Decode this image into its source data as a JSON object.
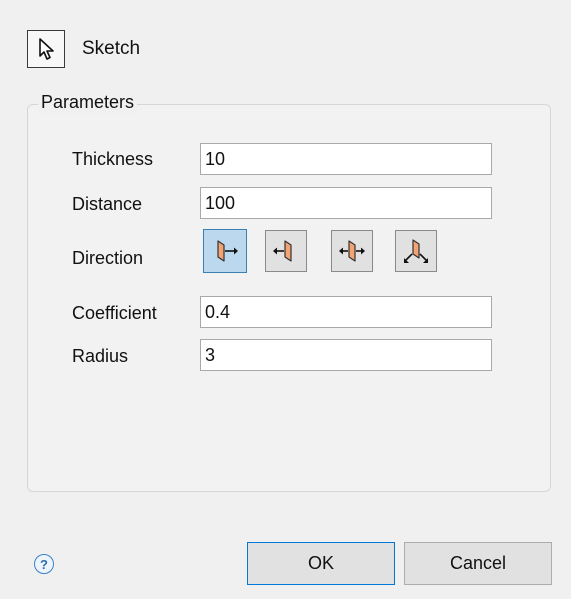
{
  "sketch": {
    "label": "Sketch",
    "icon": "cursor-arrow-icon"
  },
  "parameters": {
    "group_title": "Parameters",
    "fields": {
      "thickness": {
        "label": "Thickness",
        "value": "10"
      },
      "distance": {
        "label": "Distance",
        "value": "100"
      },
      "direction": {
        "label": "Direction"
      },
      "coefficient": {
        "label": "Coefficient",
        "value": "0.4"
      },
      "radius": {
        "label": "Radius",
        "value": "3"
      }
    },
    "direction_options": [
      {
        "icon": "direction-forward-icon",
        "selected": true
      },
      {
        "icon": "direction-reverse-icon",
        "selected": false
      },
      {
        "icon": "direction-both-icon",
        "selected": false
      },
      {
        "icon": "direction-custom-icon",
        "selected": false
      }
    ]
  },
  "footer": {
    "help_label": "?",
    "ok_label": "OK",
    "cancel_label": "Cancel"
  },
  "colors": {
    "selected_background": "#bcd8ee",
    "accent_blue": "#0078d7",
    "icon_orange": "#f0a070"
  }
}
